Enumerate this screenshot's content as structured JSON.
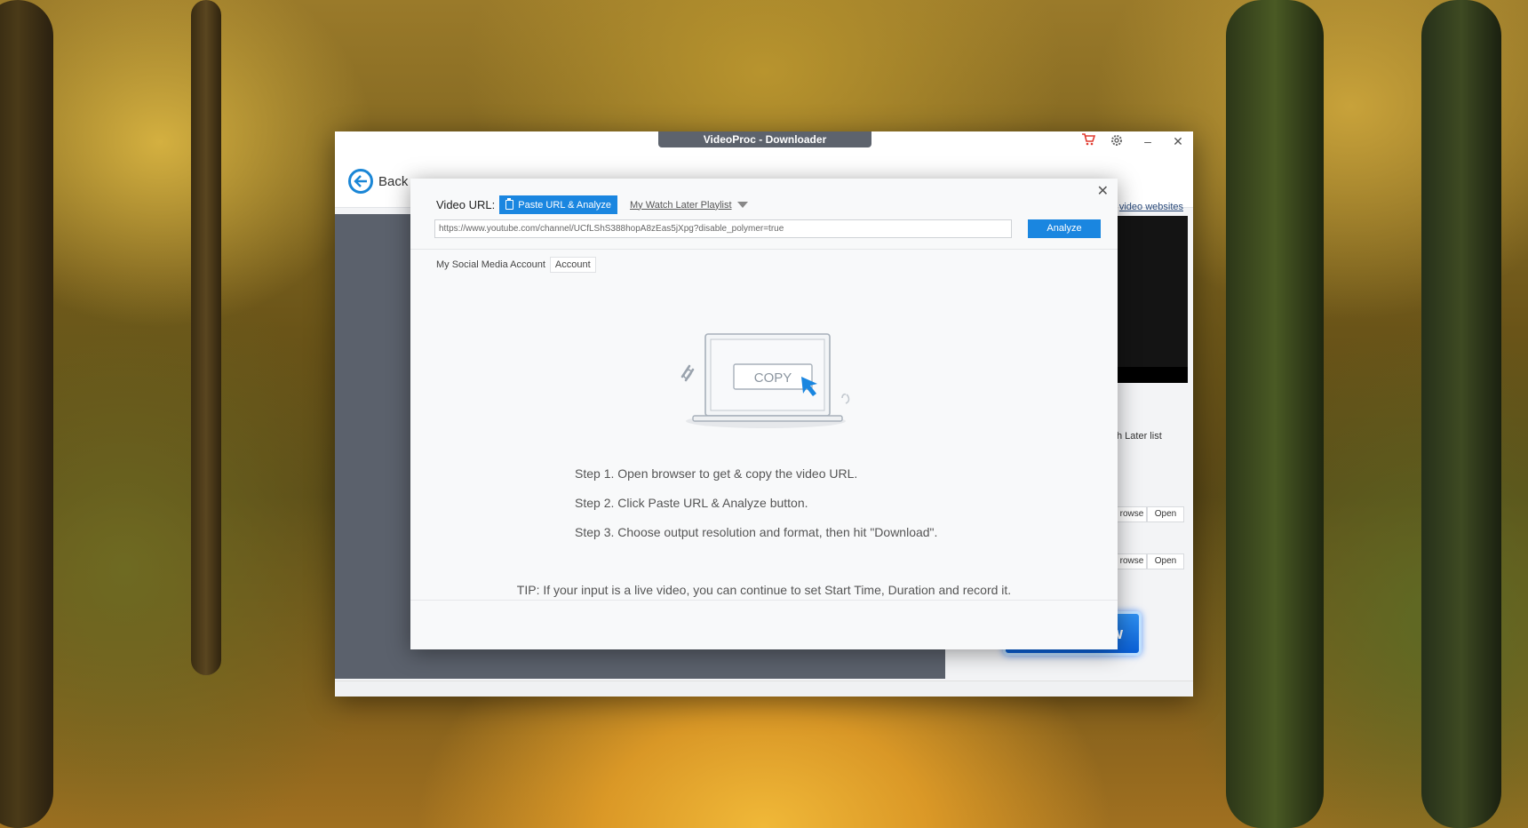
{
  "window": {
    "title": "VideoProc - Downloader",
    "controls": {
      "minimize": "–",
      "close": "✕"
    }
  },
  "toolbar": {
    "back_label": "Back",
    "websites_link": "video websites"
  },
  "side": {
    "watch_later_text": "h Later list",
    "browse_label": "rowse",
    "open_label": "Open",
    "download_label": "w"
  },
  "dialog": {
    "close": "✕",
    "video_url_label": "Video URL:",
    "paste_button": "Paste URL & Analyze",
    "watch_later_playlist": "My Watch Later Playlist",
    "url_value": "https://www.youtube.com/channel/UCfLShS388hopA8zEas5jXpg?disable_polymer=true",
    "analyze_button": "Analyze",
    "social_label": "My Social Media Account",
    "account_button": "Account",
    "copy_text": "COPY",
    "steps": [
      "Step 1. Open browser to get & copy the video URL.",
      "Step 2. Click Paste URL & Analyze button.",
      "Step 3. Choose output resolution and format, then hit \"Download\"."
    ],
    "tip": "TIP: If your input is a live video, you can continue to set Start Time, Duration and record it."
  },
  "colors": {
    "accent": "#1a86e0",
    "title_tab": "#5d636d",
    "left_panel": "#5b616c",
    "cart": "#e03a2f"
  }
}
